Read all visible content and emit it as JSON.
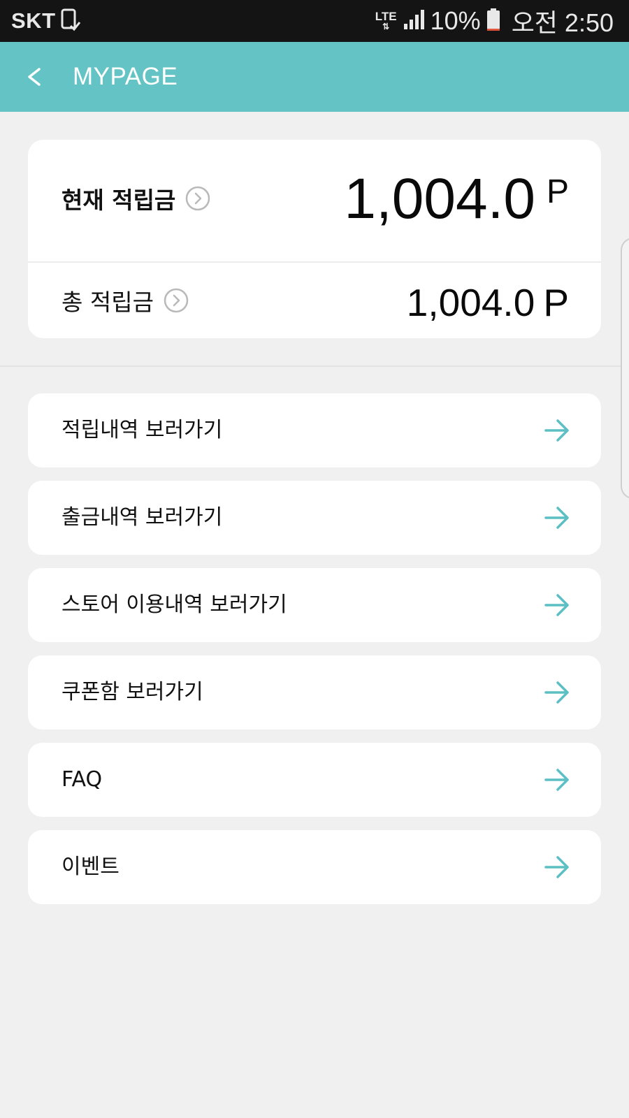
{
  "status_bar": {
    "carrier": "SKT",
    "network": "LTE",
    "battery_percent": "10%",
    "time": "오전 2:50",
    "icons": [
      "device-check-icon",
      "data-arrows-icon",
      "signal-icon",
      "battery-low-icon"
    ],
    "battery_level": 0.1,
    "colors": {
      "background": "#141414",
      "battery_low": "#e0513a"
    }
  },
  "app_bar": {
    "back_label": "<",
    "title": "MYPAGE",
    "color": "#64c4c5"
  },
  "balance": {
    "current": {
      "label": "현재 적립금",
      "amount": "1,004.0",
      "unit": "P",
      "icon": "chevron-circle-icon"
    },
    "total": {
      "label": "총 적립금",
      "amount": "1,004.0",
      "unit": "P",
      "icon": "chevron-circle-icon"
    }
  },
  "menu": {
    "items": [
      {
        "label": "적립내역 보러가기",
        "icon": "arrow-right-icon"
      },
      {
        "label": "출금내역 보러가기",
        "icon": "arrow-right-icon"
      },
      {
        "label": "스토어 이용내역 보러가기",
        "icon": "arrow-right-icon"
      },
      {
        "label": "쿠폰함 보러가기",
        "icon": "arrow-right-icon"
      },
      {
        "label": "FAQ",
        "icon": "arrow-right-icon"
      },
      {
        "label": "이벤트",
        "icon": "arrow-right-icon"
      }
    ],
    "arrow_color": "#5bbfc4"
  }
}
